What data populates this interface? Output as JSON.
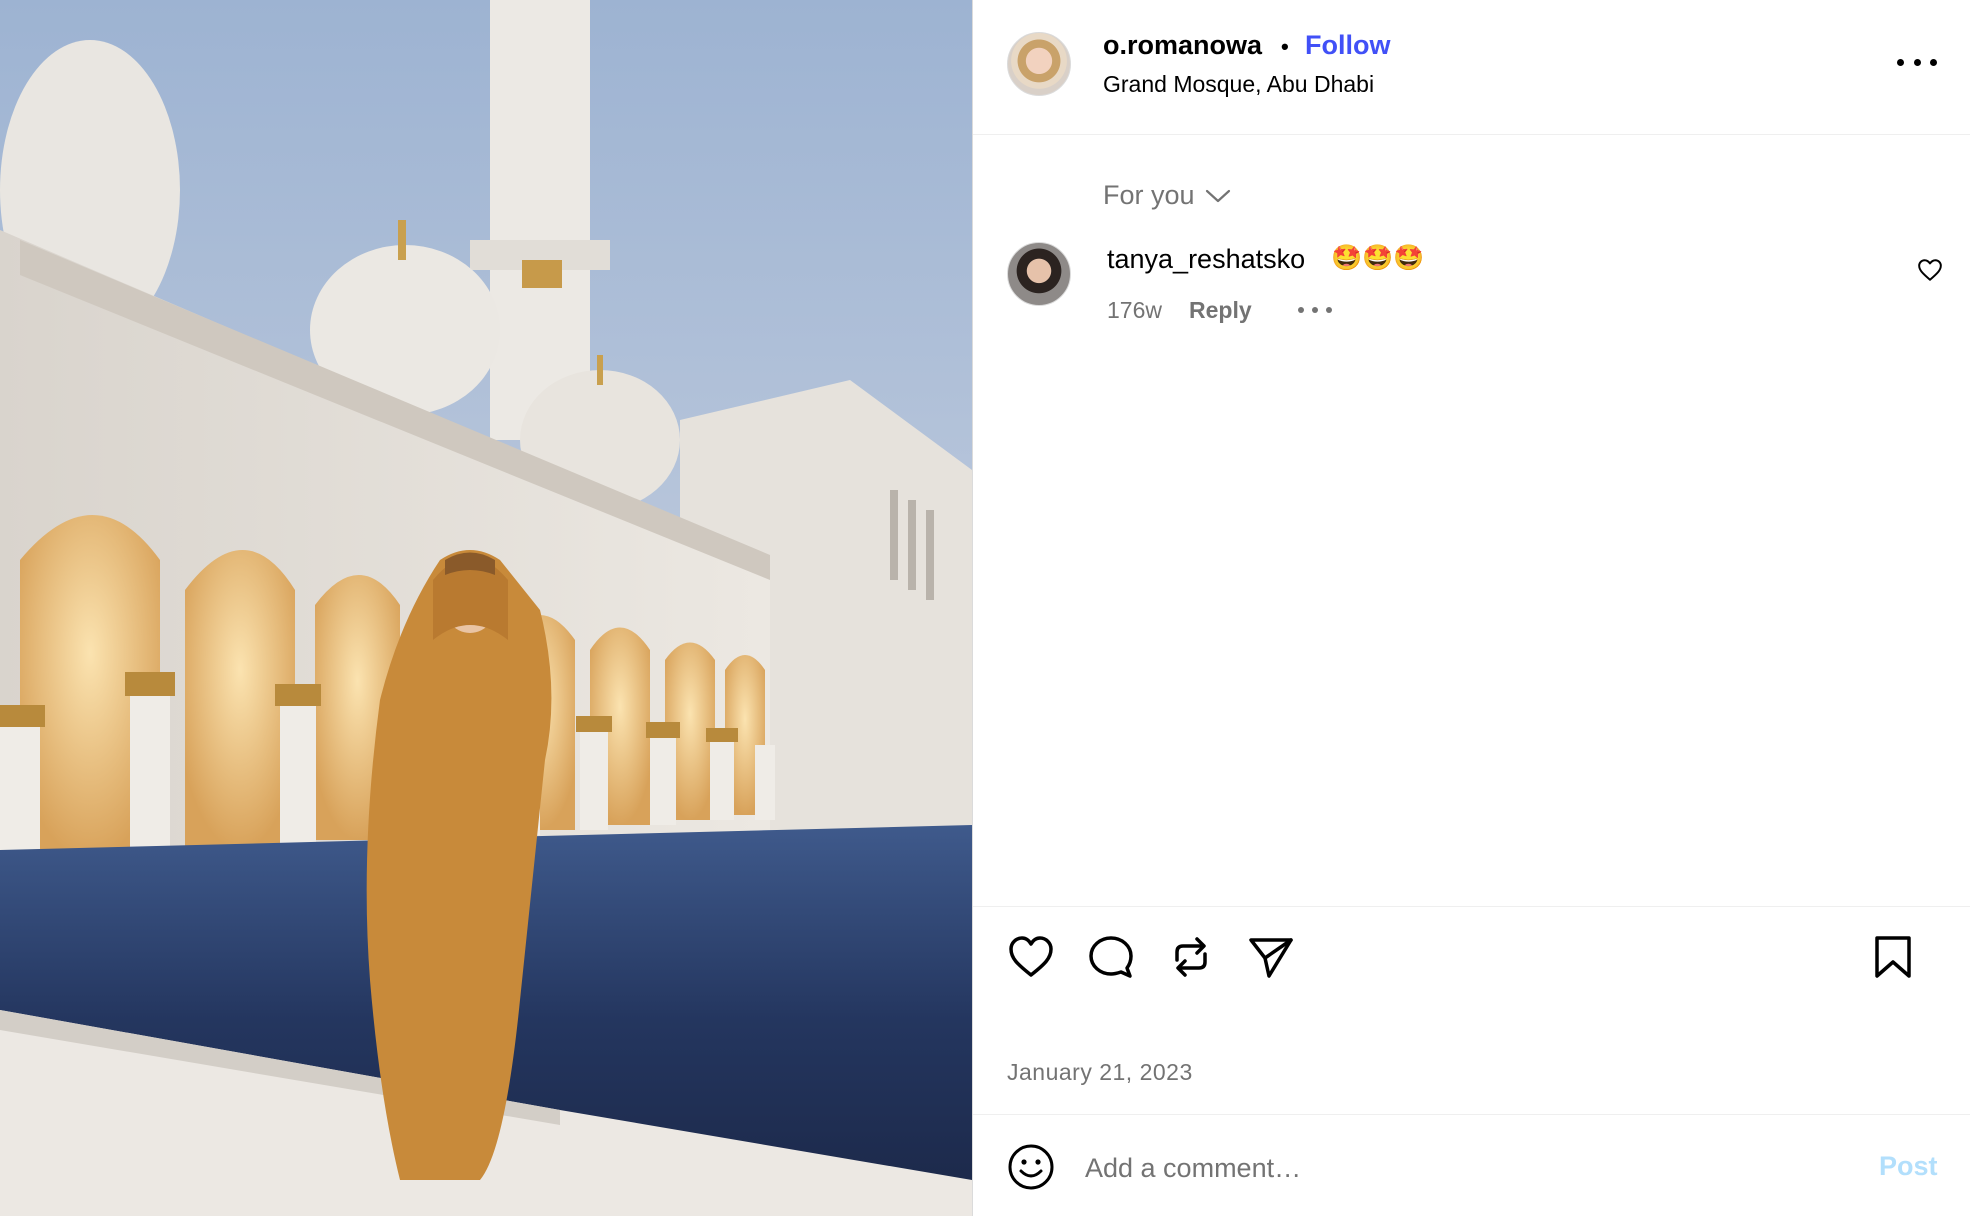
{
  "post": {
    "username": "o.romanowa",
    "follow_label": "Follow",
    "separator": "•",
    "location": "Grand Mosque, Abu Dhabi"
  },
  "comments_filter": {
    "label": "For you"
  },
  "comments": [
    {
      "username": "tanya_reshatsko",
      "text": "🤩🤩🤩",
      "time": "176w",
      "reply_label": "Reply"
    }
  ],
  "icons": {
    "more": "more-icon",
    "like": "heart-icon",
    "comment": "comment-icon",
    "repost": "repost-icon",
    "share": "send-icon",
    "save": "bookmark-icon",
    "emoji": "emoji-icon",
    "chevron": "chevron-down-icon"
  },
  "date": "January 21, 2023",
  "comment_box": {
    "placeholder": "Add a comment…",
    "post_label": "Post"
  },
  "colors": {
    "follow": "#4150f7",
    "secondary_text": "#737373",
    "post_button_disabled": "#b2dffc"
  }
}
